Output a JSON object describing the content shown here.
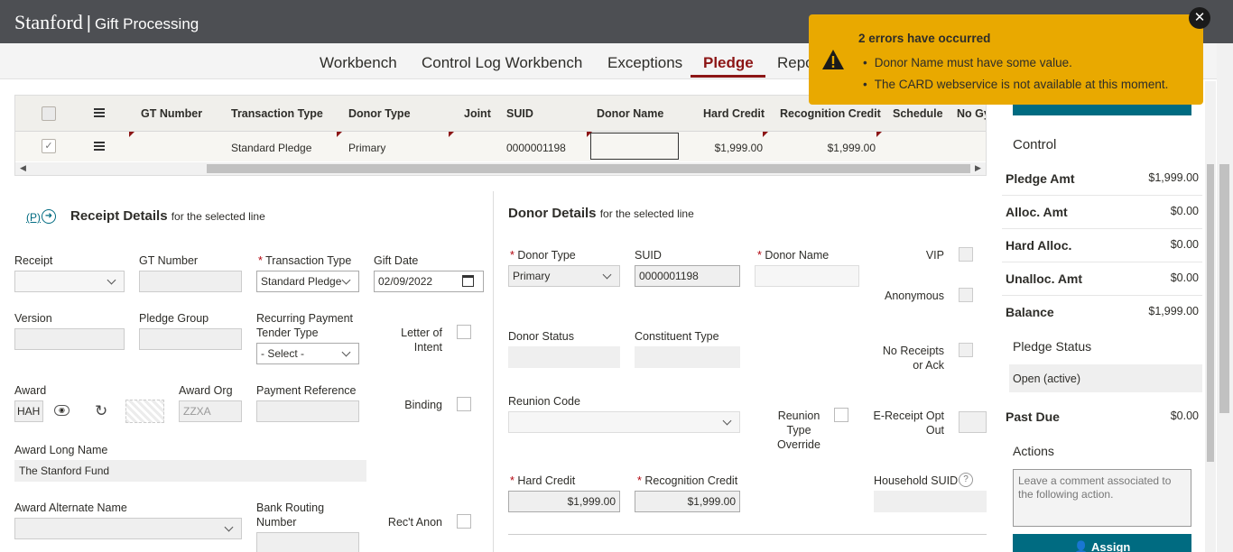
{
  "header": {
    "brand": "Stanford",
    "separator": "|",
    "app_name": "Gift Processing"
  },
  "nav": {
    "tabs": [
      "Workbench",
      "Control Log Workbench",
      "Exceptions",
      "Pledge",
      "Repo"
    ],
    "active": "Pledge"
  },
  "grid": {
    "columns": [
      "GT Number",
      "Transaction Type",
      "Donor Type",
      "Joint",
      "SUID",
      "Donor Name",
      "Hard Credit",
      "Recognition Credit",
      "Schedule",
      "No Gy"
    ],
    "row": {
      "gt_number": "",
      "transaction_type": "Standard Pledge",
      "donor_type": "Primary",
      "joint": "",
      "suid": "0000001198",
      "donor_name": "",
      "hard_credit": "$1,999.00",
      "recognition_credit": "$1,999.00"
    }
  },
  "receipt": {
    "prefix": "(P)",
    "title": "Receipt Details",
    "subtitle": "for the selected line",
    "labels": {
      "receipt": "Receipt",
      "gt_number": "GT Number",
      "transaction_type": "Transaction Type",
      "gift_date": "Gift Date",
      "version": "Version",
      "pledge_group": "Pledge Group",
      "recurring_line1": "Recurring Payment",
      "recurring_line2": "Tender Type",
      "letter_line1": "Letter of",
      "letter_line2": "Intent",
      "award": "Award",
      "award_org": "Award Org",
      "payment_reference": "Payment Reference",
      "binding": "Binding",
      "award_long_name": "Award Long Name",
      "award_alt_name": "Award Alternate Name",
      "bank_line1": "Bank Routing",
      "bank_line2": "Number",
      "rect_anon": "Rec't Anon"
    },
    "values": {
      "transaction_type": "Standard Pledge",
      "gift_date": "02/09/2022",
      "recurring_tender_type": "- Select -",
      "award": "HAH",
      "award_org": "ZZXA",
      "award_long_name": "The Stanford Fund"
    }
  },
  "donor": {
    "title": "Donor Details",
    "subtitle": "for the selected line",
    "labels": {
      "donor_type": "Donor Type",
      "suid": "SUID",
      "donor_name": "Donor Name",
      "vip": "VIP",
      "anonymous": "Anonymous",
      "donor_status": "Donor Status",
      "constituent_type": "Constituent Type",
      "no_receipts_line1": "No Receipts",
      "no_receipts_line2": "or Ack",
      "reunion_code": "Reunion Code",
      "reunion_override_line1": "Reunion",
      "reunion_override_line2": "Type",
      "reunion_override_line3": "Override",
      "ereceipt_line1": "E-Receipt Opt",
      "ereceipt_line2": "Out",
      "hard_credit": "Hard Credit",
      "recognition_credit": "Recognition Credit",
      "household_suid": "Household SUID"
    },
    "values": {
      "donor_type": "Primary",
      "suid": "0000001198",
      "hard_credit": "$1,999.00",
      "recognition_credit": "$1,999.00"
    }
  },
  "panel": {
    "control_title": "Control",
    "rows": [
      {
        "label": "Pledge Amt",
        "value": "$1,999.00"
      },
      {
        "label": "Alloc. Amt",
        "value": "$0.00"
      },
      {
        "label": "Hard Alloc.",
        "value": "$0.00"
      },
      {
        "label": "Unalloc. Amt",
        "value": "$0.00"
      },
      {
        "label": "Balance",
        "value": "$1,999.00"
      }
    ],
    "pledge_status_title": "Pledge Status",
    "pledge_status": "Open (active)",
    "past_due_label": "Past Due",
    "past_due_value": "$0.00",
    "actions_title": "Actions",
    "comment_placeholder": "Leave a comment associated to the following action.",
    "assign_label": "Assign"
  },
  "toast": {
    "title": "2 errors have occurred",
    "errors": [
      "Donor Name must have some value.",
      "The CARD webservice is not available at this moment."
    ],
    "close": "✕"
  },
  "colors": {
    "brand_red": "#8c1515",
    "teal": "#006b81",
    "toast": "#e9a900",
    "topbar": "#4d4f53"
  }
}
